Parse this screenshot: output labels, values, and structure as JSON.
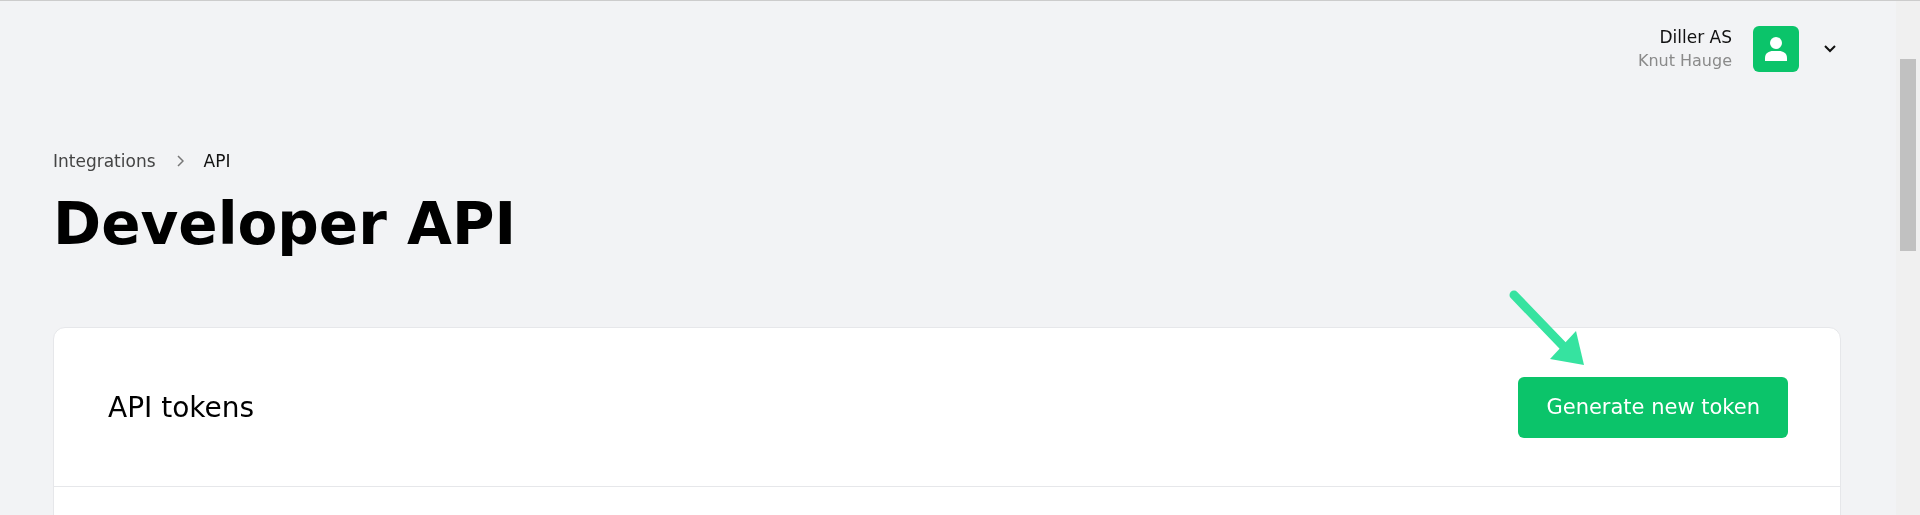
{
  "account": {
    "company": "Diller AS",
    "user": "Knut Hauge"
  },
  "breadcrumb": [
    "Integrations",
    "API"
  ],
  "page_title": "Developer API",
  "card": {
    "title": "API tokens",
    "button": "Generate new token"
  }
}
